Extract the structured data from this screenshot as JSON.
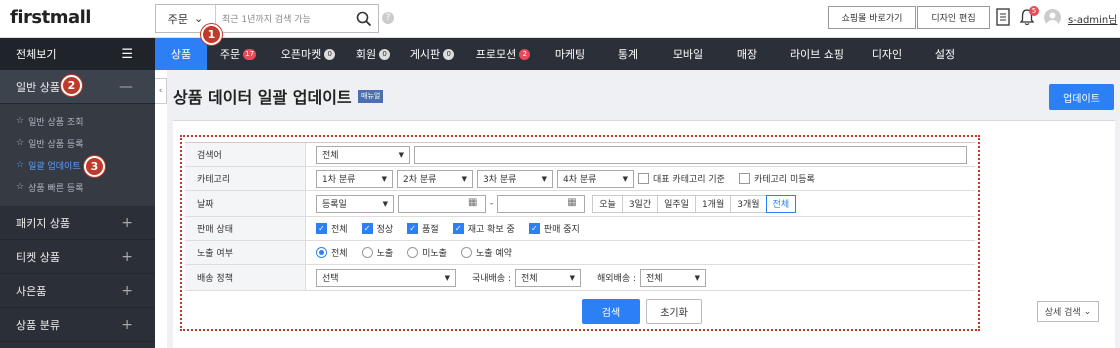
{
  "brand": {
    "logo": "firstmall"
  },
  "search": {
    "type_label": "주문",
    "placeholder": "최근 1년까지 검색 가능"
  },
  "top_buttons": {
    "shop": "쇼핑몰 바로가기",
    "design": "디자인 편집"
  },
  "user": {
    "name": "s-admin님",
    "bell_count": "5"
  },
  "sidebar": {
    "all_label": "전체보기",
    "categories": [
      {
        "label": "일반 상품",
        "expanded": true
      },
      {
        "label": "패키지 상품"
      },
      {
        "label": "티켓 상품"
      },
      {
        "label": "사은품"
      },
      {
        "label": "상품 분류"
      }
    ],
    "sub_items": [
      "일반 상품 조회",
      "일반 상품 등록",
      "일괄 업데이트",
      "상품 빠른 등록"
    ]
  },
  "nav": [
    {
      "label": "상품",
      "active": true
    },
    {
      "label": "주문",
      "badge": "17",
      "badge_color": "red"
    },
    {
      "label": "오픈마켓",
      "badge": "0",
      "badge_color": "gray"
    },
    {
      "label": "회원",
      "badge": "0",
      "badge_color": "gray"
    },
    {
      "label": "게시판",
      "badge": "0",
      "badge_color": "gray"
    },
    {
      "label": "프로모션",
      "badge": "2",
      "badge_color": "red"
    },
    {
      "label": "마케팅"
    },
    {
      "label": "통계"
    },
    {
      "label": "모바일"
    },
    {
      "label": "매장"
    },
    {
      "label": "라이브 쇼핑"
    },
    {
      "label": "디자인"
    },
    {
      "label": "설정"
    }
  ],
  "page": {
    "title": "상품 데이터 일괄 업데이트",
    "manual_tag": "매뉴얼",
    "update_button": "업데이트"
  },
  "form": {
    "keyword": {
      "label": "검색어",
      "scope": "전체"
    },
    "category": {
      "label": "카테고리",
      "selects": [
        "1차 분류",
        "2차 분류",
        "3차 분류",
        "4차 분류"
      ],
      "check_main": "대표 카테고리 기준",
      "check_unregistered": "카테고리 미등록"
    },
    "date": {
      "label": "날짜",
      "type": "등록일",
      "separator": "-",
      "periods": [
        "오늘",
        "3일간",
        "일주일",
        "1개월",
        "3개월",
        "전체"
      ],
      "active_period": "전체"
    },
    "sale_status": {
      "label": "판매 상태",
      "options": [
        "전체",
        "정상",
        "품절",
        "재고 확보 중",
        "판매 중지"
      ]
    },
    "display": {
      "label": "노출 여부",
      "options": [
        "전체",
        "노출",
        "미노출",
        "노출 예약"
      ],
      "selected": "전체"
    },
    "shipping": {
      "label": "배송 정책",
      "policy": "선택",
      "domestic_label": "국내배송 :",
      "domestic": "전체",
      "overseas_label": "해외배송 :",
      "overseas": "전체"
    }
  },
  "buttons": {
    "search": "검색",
    "reset": "초기화",
    "advanced": "상세 검색"
  },
  "markers": [
    "1",
    "2",
    "3"
  ],
  "colors": {
    "accent": "#2d7ff5",
    "sidebar": "#2b2f37",
    "marker": "#c0392b"
  }
}
